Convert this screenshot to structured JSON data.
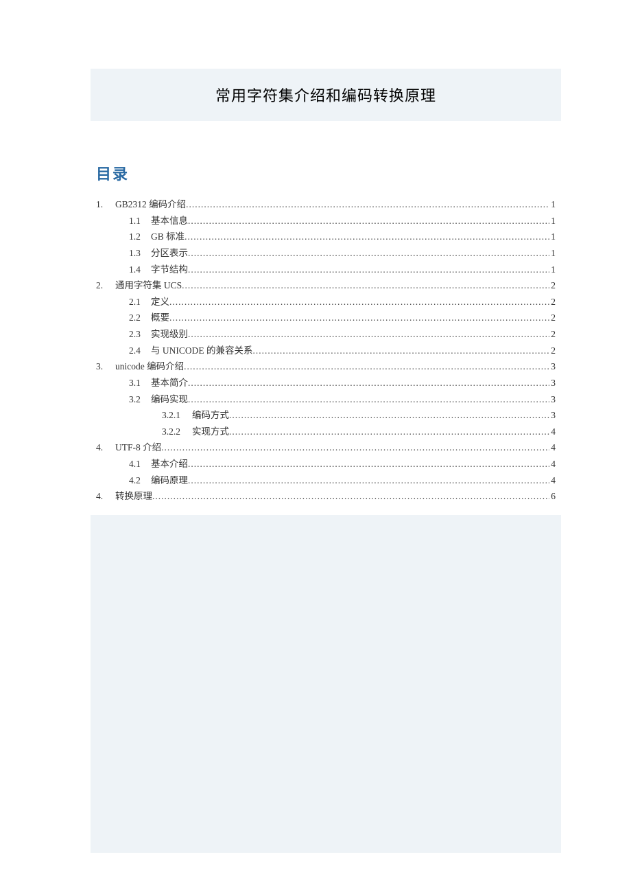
{
  "title": "常用字符集介绍和编码转换原理",
  "toc_heading": "目录",
  "toc": [
    {
      "level": 1,
      "num": "1.",
      "text": "GB2312 编码介绍",
      "page": "1"
    },
    {
      "level": 2,
      "num": "1.1",
      "text": "基本信息",
      "page": "1"
    },
    {
      "level": 2,
      "num": "1.2",
      "text": "GB 标准",
      "page": "1"
    },
    {
      "level": 2,
      "num": "1.3",
      "text": "分区表示",
      "page": "1"
    },
    {
      "level": 2,
      "num": "1.4",
      "text": "字节结构",
      "page": "1"
    },
    {
      "level": 1,
      "num": "2.",
      "text": "通用字符集 UCS",
      "page": "2"
    },
    {
      "level": 2,
      "num": "2.1",
      "text": "定义",
      "page": "2"
    },
    {
      "level": 2,
      "num": "2.2",
      "text": "概要",
      "page": "2"
    },
    {
      "level": 2,
      "num": "2.3",
      "text": "实现级别",
      "page": "2"
    },
    {
      "level": 2,
      "num": "2.4",
      "text": "与 UNICODE 的兼容关系",
      "page": "2"
    },
    {
      "level": 1,
      "num": "3.",
      "text": "unicode 编码介绍",
      "page": "3"
    },
    {
      "level": 2,
      "num": "3.1",
      "text": "基本简介",
      "page": "3"
    },
    {
      "level": 2,
      "num": "3.2",
      "text": "编码实现",
      "page": "3"
    },
    {
      "level": 3,
      "num": "3.2.1",
      "text": "编码方式",
      "page": "3"
    },
    {
      "level": 3,
      "num": "3.2.2",
      "text": "实现方式",
      "page": "4"
    },
    {
      "level": 1,
      "num": "4.",
      "text": "UTF-8 介绍",
      "page": "4"
    },
    {
      "level": 2,
      "num": "4.1",
      "text": "基本介绍",
      "page": "4"
    },
    {
      "level": 2,
      "num": "4.2",
      "text": "编码原理",
      "page": "4"
    },
    {
      "level": 1,
      "num": "4.",
      "text": "转换原理",
      "page": "6"
    }
  ]
}
